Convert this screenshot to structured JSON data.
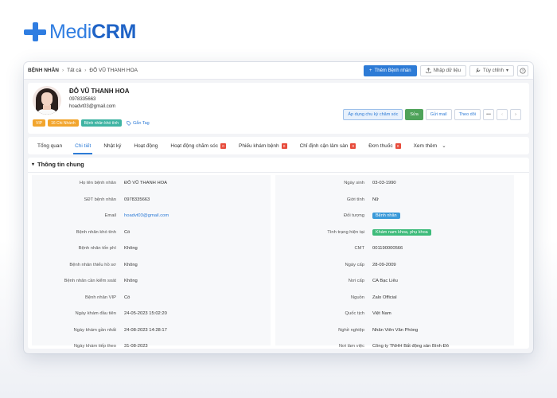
{
  "logo": {
    "part1": "Medi",
    "part2": "CRM"
  },
  "topbar": {
    "crumb_root": "BỆNH NHÂN",
    "crumb_mid": "Tất cả",
    "crumb_current": "ĐỖ VŨ THANH HOA",
    "add_label": "Thêm Bệnh nhân",
    "import_label": "Nhập dữ liệu",
    "custom_label": "Tùy chỉnh"
  },
  "profile": {
    "name": "ĐỖ VŨ THANH HOA",
    "phone": "0978335663",
    "email": "hoadvt03@gmail.com",
    "tags": [
      "VIP",
      "16 Chi Nhánh",
      "Bệnh nhân khó tính"
    ],
    "add_tag_label": "Gắn Tag",
    "actions": {
      "apply": "Áp dụng chu kỳ chăm sóc",
      "edit": "Sửa",
      "mail": "Gửi mail",
      "follow": "Theo dõi"
    }
  },
  "tabs": [
    {
      "label": "Tổng quan",
      "badge": null
    },
    {
      "label": "Chi tiết",
      "badge": null
    },
    {
      "label": "Nhật ký",
      "badge": null
    },
    {
      "label": "Hoạt động",
      "badge": null
    },
    {
      "label": "Hoạt động chăm sóc",
      "badge": "0"
    },
    {
      "label": "Phiếu khám bệnh",
      "badge": "0"
    },
    {
      "label": "Chỉ định cận lâm sàn",
      "badge": "0"
    },
    {
      "label": "Đơn thuốc",
      "badge": "0"
    },
    {
      "label": "Xem thêm",
      "badge": null
    }
  ],
  "section": {
    "title": "Thông tin chung"
  },
  "left_fields": [
    {
      "label": "Họ tên bệnh nhân",
      "value": "ĐỖ VŨ THANH HOA"
    },
    {
      "label": "SĐT bệnh nhân",
      "value": "0978335663"
    },
    {
      "label": "Email",
      "value": "hoadvt03@gmail.com"
    },
    {
      "label": "Bệnh nhân khó tính",
      "value": "Có"
    },
    {
      "label": "Bệnh nhân tốn phí",
      "value": "Không"
    },
    {
      "label": "Bệnh nhân thiếu hồ sơ",
      "value": "Không"
    },
    {
      "label": "Bệnh nhân cần kiểm soát",
      "value": "Không"
    },
    {
      "label": "Bệnh nhân VIP",
      "value": "Có"
    },
    {
      "label": "Ngày khám đầu tiên",
      "value": "24-05-2023 15:02:20"
    },
    {
      "label": "Ngày khám gần nhất",
      "value": "24-08-2023 14:28:17"
    },
    {
      "label": "Ngày khám tiếp theo",
      "value": "31-08-2023"
    }
  ],
  "right_fields": [
    {
      "label": "Ngày sinh",
      "value": "03-03-1990"
    },
    {
      "label": "Giới tính",
      "value": "Nữ"
    },
    {
      "label": "Đối tượng",
      "value": "Bệnh nhân"
    },
    {
      "label": "Tình trạng hiện tại",
      "value": "Khám nam khoa, phụ khoa"
    },
    {
      "label": "CMT",
      "value": "001190000566"
    },
    {
      "label": "Ngày cấp",
      "value": "28-09-2009"
    },
    {
      "label": "Nơi cấp",
      "value": "CA Bạc Liêu"
    },
    {
      "label": "Nguồn",
      "value": "Zalo Official"
    },
    {
      "label": "Quốc tịch",
      "value": "Việt Nam"
    },
    {
      "label": "Nghề nghiệp",
      "value": "Nhân Viên Văn Phòng"
    },
    {
      "label": "Nơi làm việc",
      "value": "Công ty TNHH Bất động sản Bình Đô"
    }
  ]
}
